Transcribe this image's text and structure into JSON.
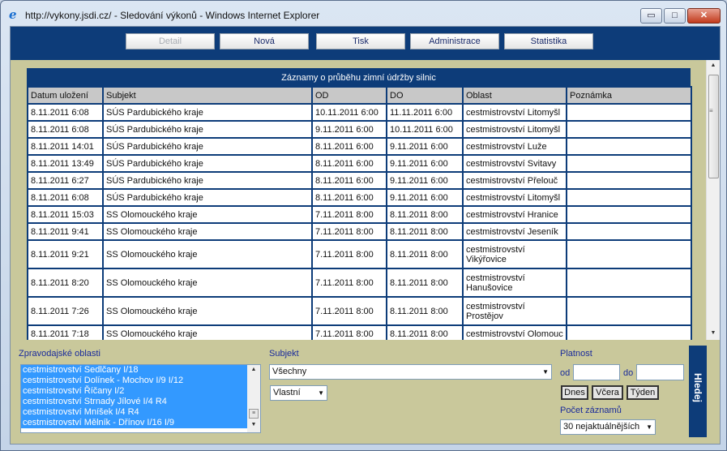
{
  "window": {
    "title": "http://vykony.jsdi.cz/ - Sledování výkonů - Windows Internet Explorer",
    "controls": {
      "minimize": "▭",
      "maximize": "□",
      "close": "✕"
    }
  },
  "toolbar": {
    "buttons": [
      "Detail",
      "Nová",
      "Tisk",
      "Administrace",
      "Statistika"
    ]
  },
  "table": {
    "caption": "Záznamy o průběhu zimní údržby silnic",
    "columns": [
      "Datum uložení",
      "Subjekt",
      "OD",
      "DO",
      "Oblast",
      "Poznámka"
    ],
    "rows": [
      [
        "8.11.2011 6:08",
        "SÚS Pardubického kraje",
        "10.11.2011 6:00",
        "11.11.2011 6:00",
        "cestmistrovství Litomyšl",
        ""
      ],
      [
        "8.11.2011 6:08",
        "SÚS Pardubického kraje",
        "9.11.2011 6:00",
        "10.11.2011 6:00",
        "cestmistrovství Litomyšl",
        ""
      ],
      [
        "8.11.2011 14:01",
        "SÚS Pardubického kraje",
        "8.11.2011 6:00",
        "9.11.2011 6:00",
        "cestmistrovství Luže",
        ""
      ],
      [
        "8.11.2011 13:49",
        "SÚS Pardubického kraje",
        "8.11.2011 6:00",
        "9.11.2011 6:00",
        "cestmistrovství Svitavy",
        ""
      ],
      [
        "8.11.2011 6:27",
        "SÚS Pardubického kraje",
        "8.11.2011 6:00",
        "9.11.2011 6:00",
        "cestmistrovství Přelouč",
        ""
      ],
      [
        "8.11.2011 6:08",
        "SÚS Pardubického kraje",
        "8.11.2011 6:00",
        "9.11.2011 6:00",
        "cestmistrovství Litomyšl",
        ""
      ],
      [
        "8.11.2011 15:03",
        "SS Olomouckého kraje",
        "7.11.2011 8:00",
        "8.11.2011 8:00",
        "cestmistrovství Hranice",
        ""
      ],
      [
        "8.11.2011 9:41",
        "SS Olomouckého kraje",
        "7.11.2011 8:00",
        "8.11.2011 8:00",
        "cestmistrovství Jeseník",
        ""
      ],
      [
        "8.11.2011 9:21",
        "SS Olomouckého kraje",
        "7.11.2011 8:00",
        "8.11.2011 8:00",
        "cestmistrovství Vikýřovice",
        ""
      ],
      [
        "8.11.2011 8:20",
        "SS Olomouckého kraje",
        "7.11.2011 8:00",
        "8.11.2011 8:00",
        "cestmistrovství Hanušovice",
        ""
      ],
      [
        "8.11.2011 7:26",
        "SS Olomouckého kraje",
        "7.11.2011 8:00",
        "8.11.2011 8:00",
        "cestmistrovství Prostějov",
        ""
      ],
      [
        "8.11.2011 7:18",
        "SS Olomouckého kraje",
        "7.11.2011 8:00",
        "8.11.2011 8:00",
        "cestmistrovství Olomouc",
        ""
      ]
    ]
  },
  "filter": {
    "areas_label": "Zpravodajské oblasti",
    "areas": [
      "cestmistrovství Sedlčany I/18",
      "cestmistrovství Dolínek - Mochov I/9 I/12",
      "cestmistrovství Říčany I/2",
      "cestmistrovství Strnady Jílové I/4 R4",
      "cestmistrovství Mníšek I/4 R4",
      "cestmistrovství Mělník - Dřínov I/16 I/9"
    ],
    "subject_label": "Subjekt",
    "subject_value": "Všechny",
    "owner_value": "Vlastní",
    "validity_label": "Platnost",
    "from_label": "od",
    "to_label": "do",
    "today_label": "Dnes",
    "yesterday_label": "Včera",
    "week_label": "Týden",
    "count_label": "Počet záznamů",
    "count_value": "30 nejaktuálnějších",
    "search_label": "Hledej"
  }
}
